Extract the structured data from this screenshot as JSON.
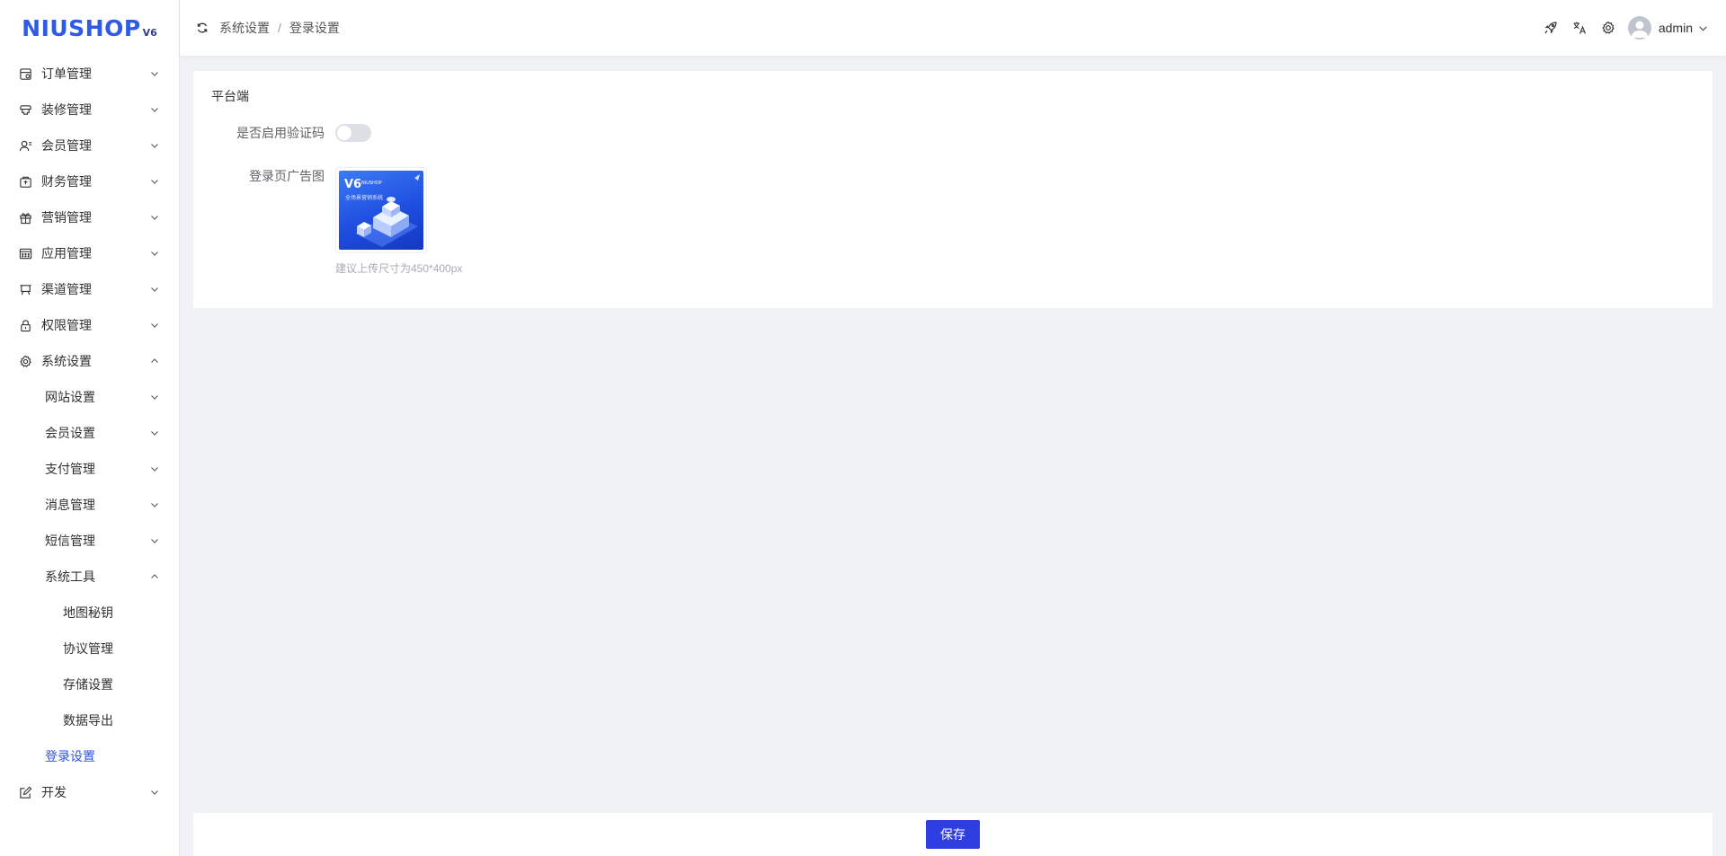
{
  "brand": {
    "logo_text": "NIUSHOP",
    "logo_version": "V6"
  },
  "sidebar": {
    "items": [
      {
        "label": "订单管理",
        "icon": "order-icon"
      },
      {
        "label": "装修管理",
        "icon": "decoration-icon"
      },
      {
        "label": "会员管理",
        "icon": "member-icon"
      },
      {
        "label": "财务管理",
        "icon": "finance-icon"
      },
      {
        "label": "营销管理",
        "icon": "gift-icon"
      },
      {
        "label": "应用管理",
        "icon": "app-grid-icon"
      },
      {
        "label": "渠道管理",
        "icon": "channel-icon"
      },
      {
        "label": "权限管理",
        "icon": "lock-icon"
      },
      {
        "label": "系统设置",
        "icon": "gear-icon",
        "expanded": true
      }
    ],
    "system_children": [
      {
        "label": "网站设置"
      },
      {
        "label": "会员设置"
      },
      {
        "label": "支付管理"
      },
      {
        "label": "消息管理"
      },
      {
        "label": "短信管理"
      },
      {
        "label": "系统工具",
        "expanded": true
      }
    ],
    "tool_children": [
      {
        "label": "地图秘钥"
      },
      {
        "label": "协议管理"
      },
      {
        "label": "存储设置"
      },
      {
        "label": "数据导出"
      }
    ],
    "login_settings": {
      "label": "登录设置",
      "active": true
    },
    "dev": {
      "label": "开发",
      "icon": "edit-icon"
    }
  },
  "header": {
    "breadcrumb": [
      "系统设置",
      "登录设置"
    ],
    "separator": "/",
    "username": "admin"
  },
  "form": {
    "section_title": "平台端",
    "captcha_label": "是否启用验证码",
    "captcha_enabled": false,
    "ad_label": "登录页广告图",
    "ad_image": {
      "v6": "V6",
      "brand": "NIUSHOP",
      "sub": "全场景营销系统"
    },
    "ad_hint": "建议上传尺寸为450*400px"
  },
  "footer": {
    "save_label": "保存"
  },
  "colors": {
    "primary": "#2f3ee0",
    "active_text": "#2e54e0",
    "logo": "#2f5ae6"
  }
}
